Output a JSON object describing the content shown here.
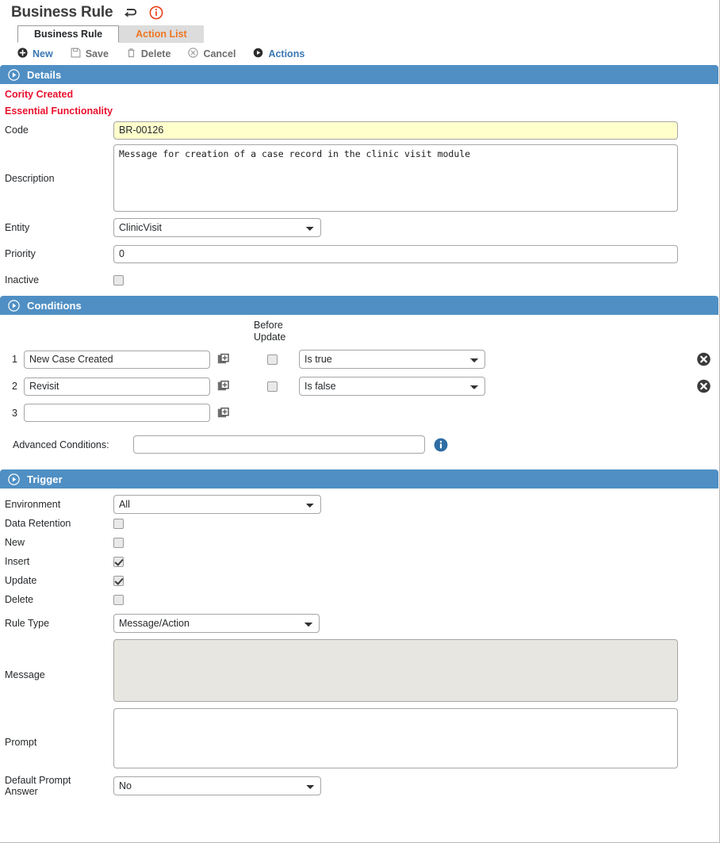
{
  "header": {
    "title": "Business Rule",
    "back_icon": "back-arrow-icon",
    "info_icon": "alert-info-icon"
  },
  "tabs": [
    {
      "label": "Business Rule",
      "active": true
    },
    {
      "label": "Action List",
      "active": false
    }
  ],
  "toolbar": [
    {
      "label": "New",
      "icon": "plus-circle-icon",
      "enabled": true
    },
    {
      "label": "Save",
      "icon": "save-disk-icon",
      "enabled": false
    },
    {
      "label": "Delete",
      "icon": "trash-icon",
      "enabled": false
    },
    {
      "label": "Cancel",
      "icon": "cancel-circle-icon",
      "enabled": false
    },
    {
      "label": "Actions",
      "icon": "play-circle-icon",
      "enabled": true
    }
  ],
  "details": {
    "section_title": "Details",
    "notice_1": "Cority Created",
    "notice_2": "Essential Functionality",
    "code_label": "Code",
    "code_value": "BR-00126",
    "description_label": "Description",
    "description_value": "Message for creation of a case record in the clinic visit module",
    "entity_label": "Entity",
    "entity_value": "ClinicVisit",
    "priority_label": "Priority",
    "priority_value": "0",
    "inactive_label": "Inactive",
    "inactive_checked": false
  },
  "conditions": {
    "section_title": "Conditions",
    "col_before": "Before",
    "col_update": "Update",
    "rows": [
      {
        "num": "1",
        "field": "New Case Created",
        "before_update": false,
        "operator": "Is true",
        "has_delete": true
      },
      {
        "num": "2",
        "field": "Revisit",
        "before_update": false,
        "operator": "Is false",
        "has_delete": true
      },
      {
        "num": "3",
        "field": "",
        "before_update": null,
        "operator": "",
        "has_delete": false
      }
    ],
    "advanced_label": "Advanced Conditions:",
    "advanced_value": "",
    "info_icon": "info-circle-icon"
  },
  "trigger": {
    "section_title": "Trigger",
    "environment_label": "Environment",
    "environment_value": "All",
    "checkboxes": [
      {
        "label": "Data Retention",
        "checked": false
      },
      {
        "label": "New",
        "checked": false
      },
      {
        "label": "Insert",
        "checked": true
      },
      {
        "label": "Update",
        "checked": true
      },
      {
        "label": "Delete",
        "checked": false
      }
    ],
    "rule_type_label": "Rule Type",
    "rule_type_value": "Message/Action",
    "message_label": "Message",
    "message_value": "",
    "prompt_label": "Prompt",
    "prompt_value": "",
    "default_prompt_label_1": "Default Prompt",
    "default_prompt_label_2": "Answer",
    "default_prompt_value": "No"
  },
  "colors": {
    "section_blue": "#4f8fc4",
    "notice_red": "#e8112d",
    "tab_orange": "#ef7622",
    "link_blue": "#3a77b5",
    "code_yellow": "#ffffcc",
    "disabled_gray": "#e8e6e0"
  }
}
